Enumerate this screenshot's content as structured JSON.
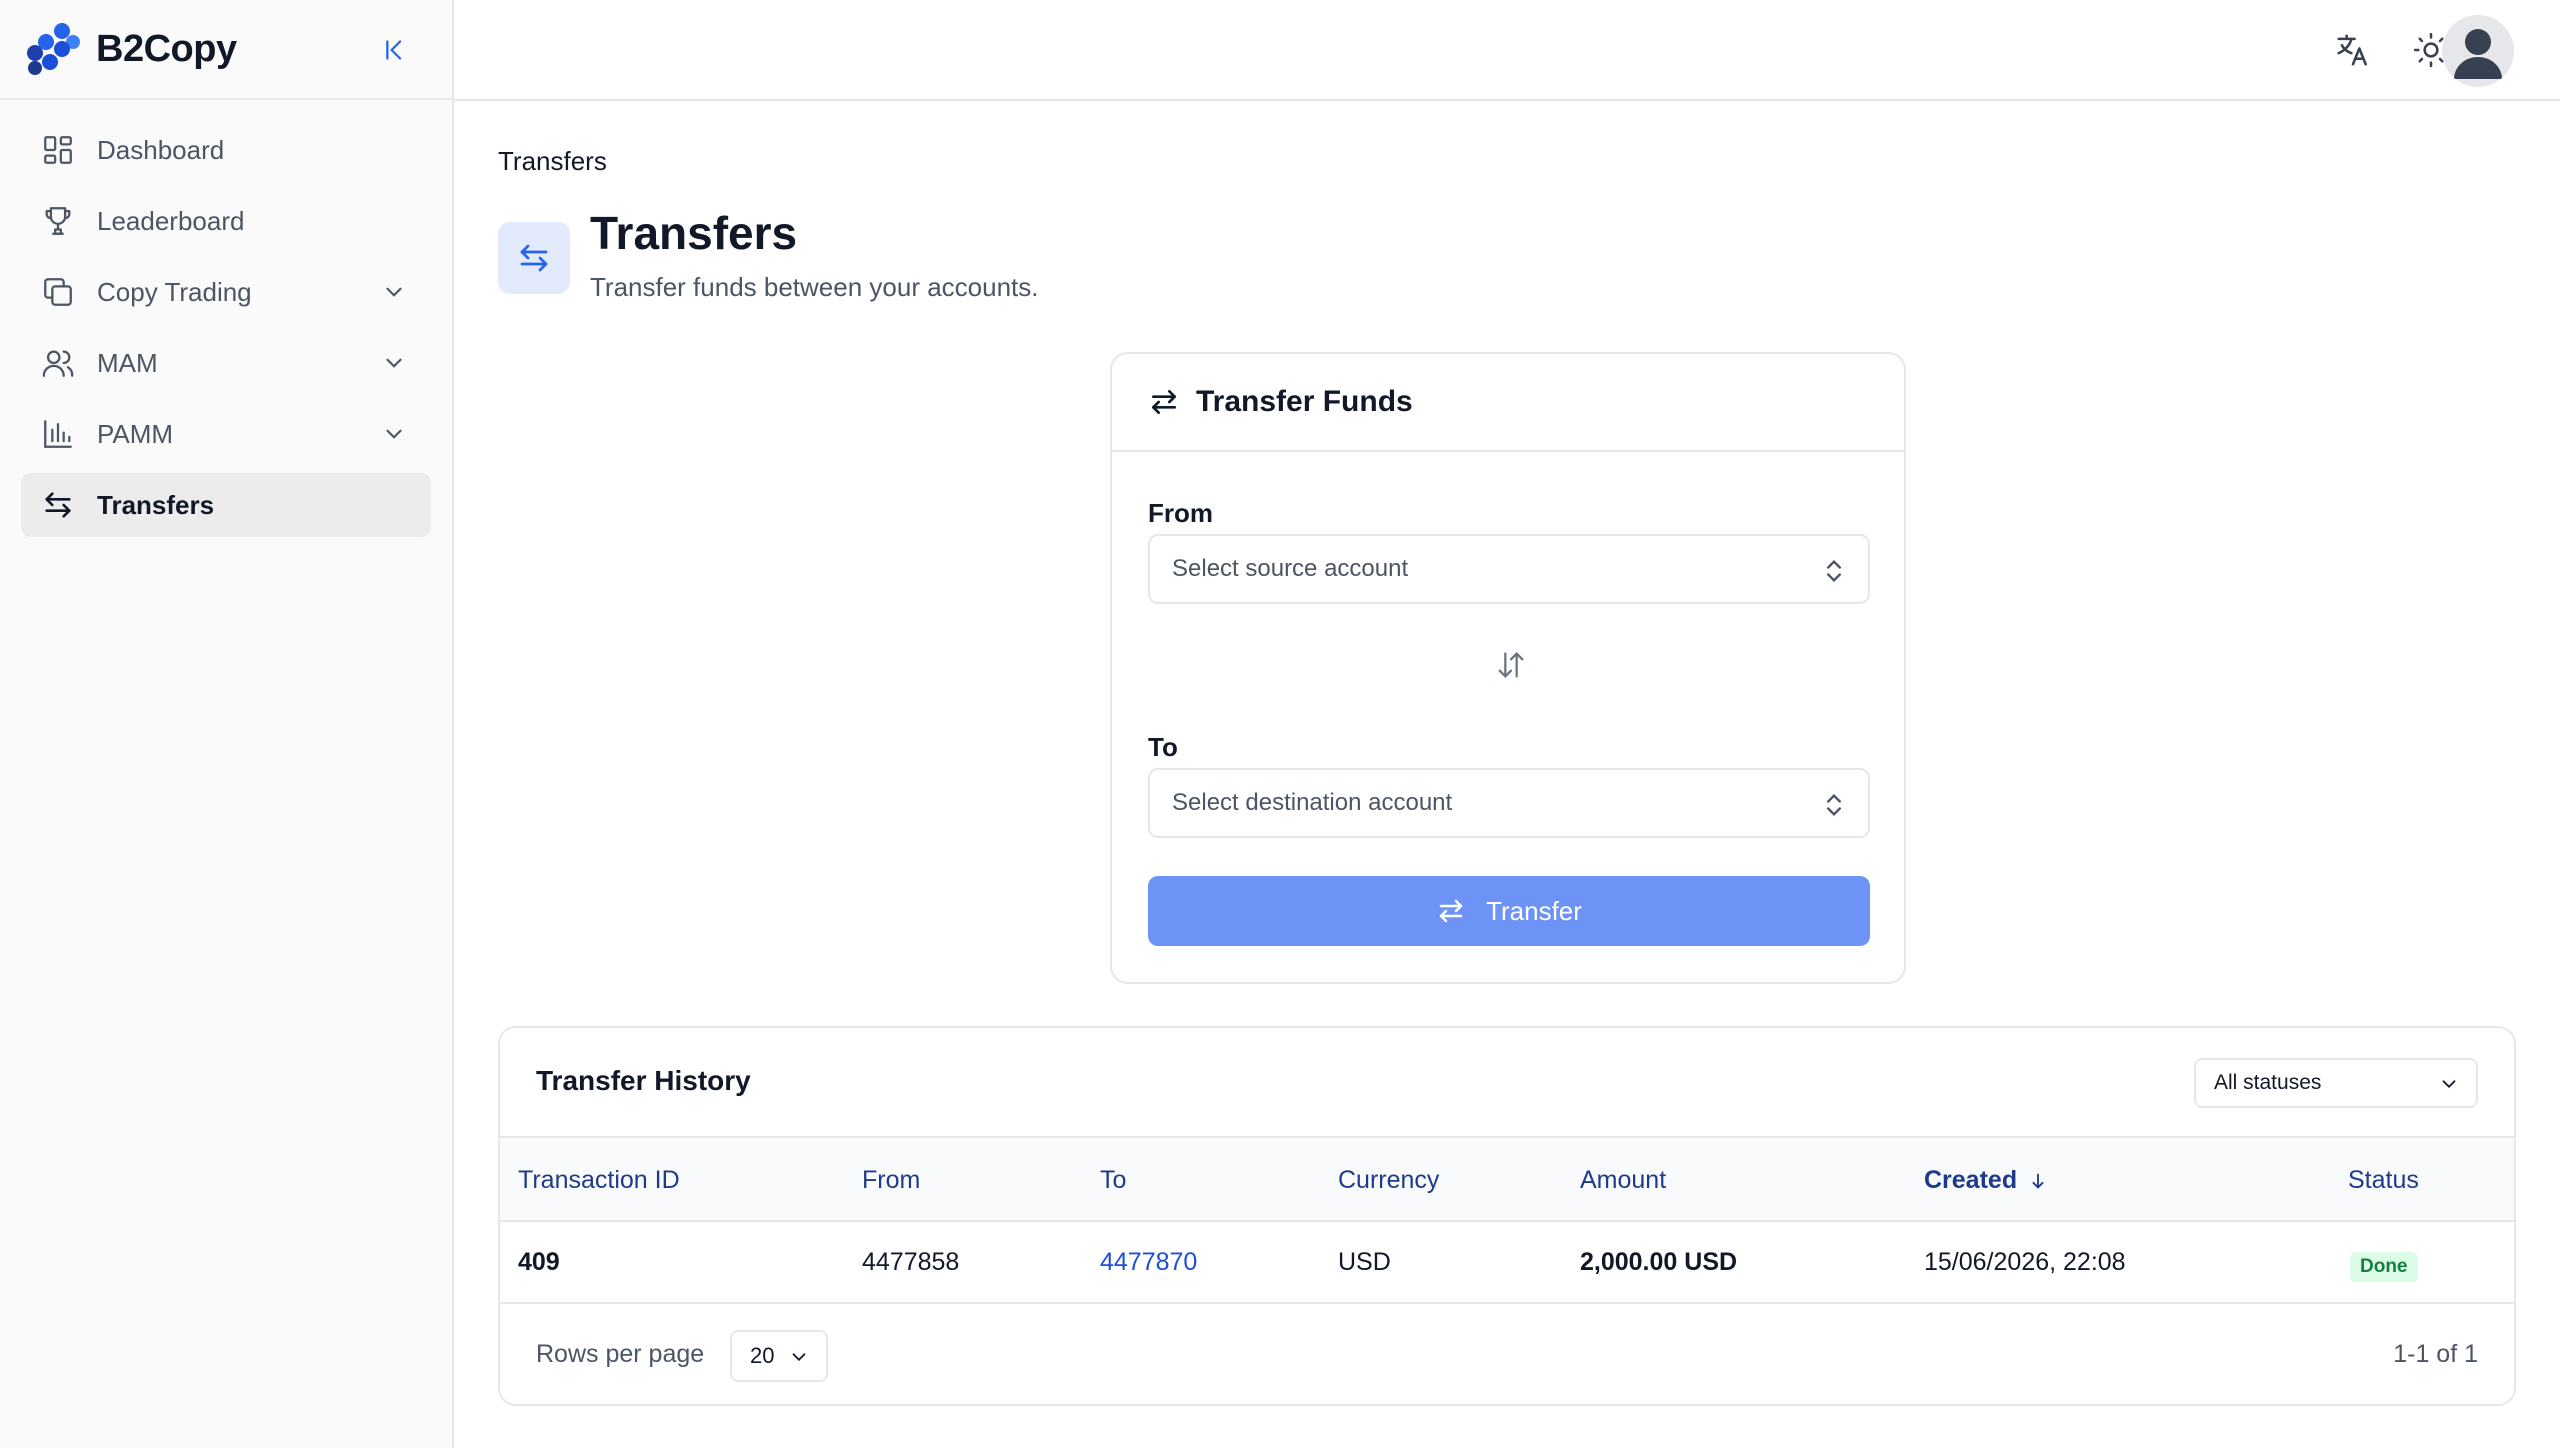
{
  "app": {
    "name": "B2Copy"
  },
  "sidebar": {
    "items": [
      {
        "label": "Dashboard",
        "icon": "dashboard-icon",
        "has_submenu": false,
        "active": false
      },
      {
        "label": "Leaderboard",
        "icon": "trophy-icon",
        "has_submenu": false,
        "active": false
      },
      {
        "label": "Copy Trading",
        "icon": "copy-icon",
        "has_submenu": true,
        "active": false
      },
      {
        "label": "MAM",
        "icon": "users-icon",
        "has_submenu": true,
        "active": false
      },
      {
        "label": "PAMM",
        "icon": "bar-chart-icon",
        "has_submenu": true,
        "active": false
      },
      {
        "label": "Transfers",
        "icon": "transfer-arrows-icon",
        "has_submenu": false,
        "active": true
      }
    ]
  },
  "topbar": {
    "icons": [
      "translate-icon",
      "theme-sun-icon",
      "user-avatar-icon"
    ]
  },
  "breadcrumb": "Transfers",
  "page": {
    "title": "Transfers",
    "subtitle": "Transfer funds between your accounts."
  },
  "transfer_card": {
    "title": "Transfer Funds",
    "from_label": "From",
    "from_placeholder": "Select source account",
    "to_label": "To",
    "to_placeholder": "Select destination account",
    "button_label": "Transfer"
  },
  "history": {
    "title": "Transfer History",
    "status_filter": "All statuses",
    "columns": [
      "Transaction ID",
      "From",
      "To",
      "Currency",
      "Amount",
      "Created",
      "Status"
    ],
    "sorted_column": "Created",
    "rows": [
      {
        "transaction_id": "409",
        "from": "4477858",
        "to": "4477870",
        "currency": "USD",
        "amount": "2,000.00 USD",
        "created": "15/06/2026, 22:08",
        "status": "Done"
      }
    ],
    "rows_per_page_label": "Rows per page",
    "rows_per_page": "20",
    "page_info": "1-1 of 1"
  },
  "colors": {
    "accent": "#6c93f5",
    "link": "#1d4ed8",
    "header_text": "#1e3a8a",
    "badge_bg": "#dcfce7",
    "badge_text": "#15803d"
  }
}
